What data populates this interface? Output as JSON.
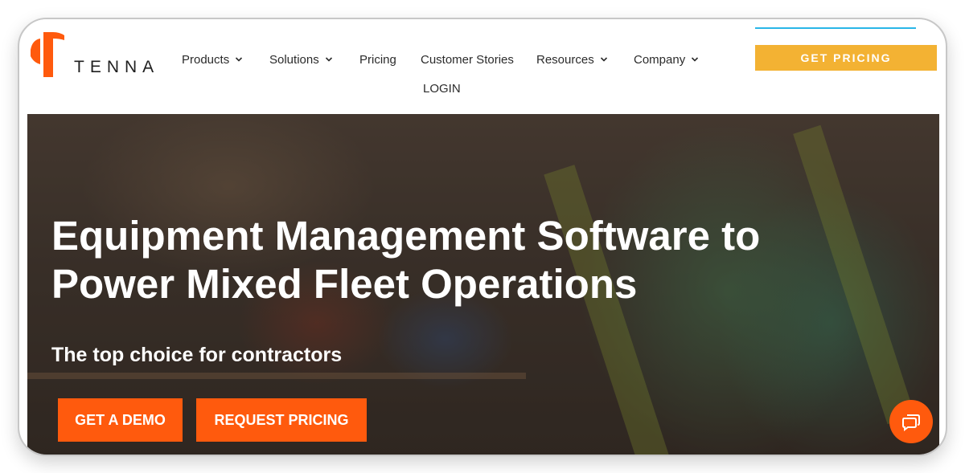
{
  "brand": {
    "name": "TENNA",
    "logo_color": "#ff5a0d",
    "logo_icon": "tenna-logo-mark"
  },
  "nav": {
    "items": [
      {
        "label": "Products",
        "has_dropdown": true
      },
      {
        "label": "Solutions",
        "has_dropdown": true
      },
      {
        "label": "Pricing",
        "has_dropdown": false
      },
      {
        "label": "Customer Stories",
        "has_dropdown": false
      },
      {
        "label": "Resources",
        "has_dropdown": true
      },
      {
        "label": "Company",
        "has_dropdown": true
      }
    ],
    "login": "LOGIN",
    "cta": "GET PRICING",
    "cta_color": "#f3b233"
  },
  "hero": {
    "title_line1": "Equipment Management Software to",
    "title_line2": "Power Mixed Fleet Operations",
    "subtitle": "The top choice for contractors",
    "buttons": {
      "demo": "GET A DEMO",
      "pricing": "REQUEST PRICING"
    },
    "button_color": "#ff5a0d"
  },
  "chat": {
    "icon": "chat-bubble-icon"
  }
}
